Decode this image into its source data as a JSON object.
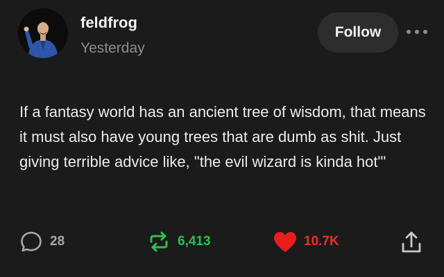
{
  "post": {
    "author": {
      "username": "feldfrog",
      "avatar_icon": "user-avatar-icon"
    },
    "timestamp": "Yesterday",
    "follow_label": "Follow",
    "more_icon": "more-horizontal-icon",
    "body": "If a fantasy world has an ancient tree of wisdom, that means it must also have young trees that are dumb as shit. Just giving terrible advice like, \"the evil wizard is kinda hot\"'"
  },
  "actions": {
    "comments": {
      "icon": "comment-icon",
      "count": "28",
      "color": "#a8a8a8"
    },
    "reblogs": {
      "icon": "reblog-icon",
      "count": "6,413",
      "color": "#2fbf53"
    },
    "likes": {
      "icon": "heart-icon",
      "count": "10.7K",
      "color": "#ea2e2e"
    },
    "share": {
      "icon": "share-icon"
    }
  },
  "colors": {
    "background": "#1b1b1b",
    "text": "#ececec",
    "muted": "#8d8d8d",
    "button_bg": "#2d2d2d"
  }
}
